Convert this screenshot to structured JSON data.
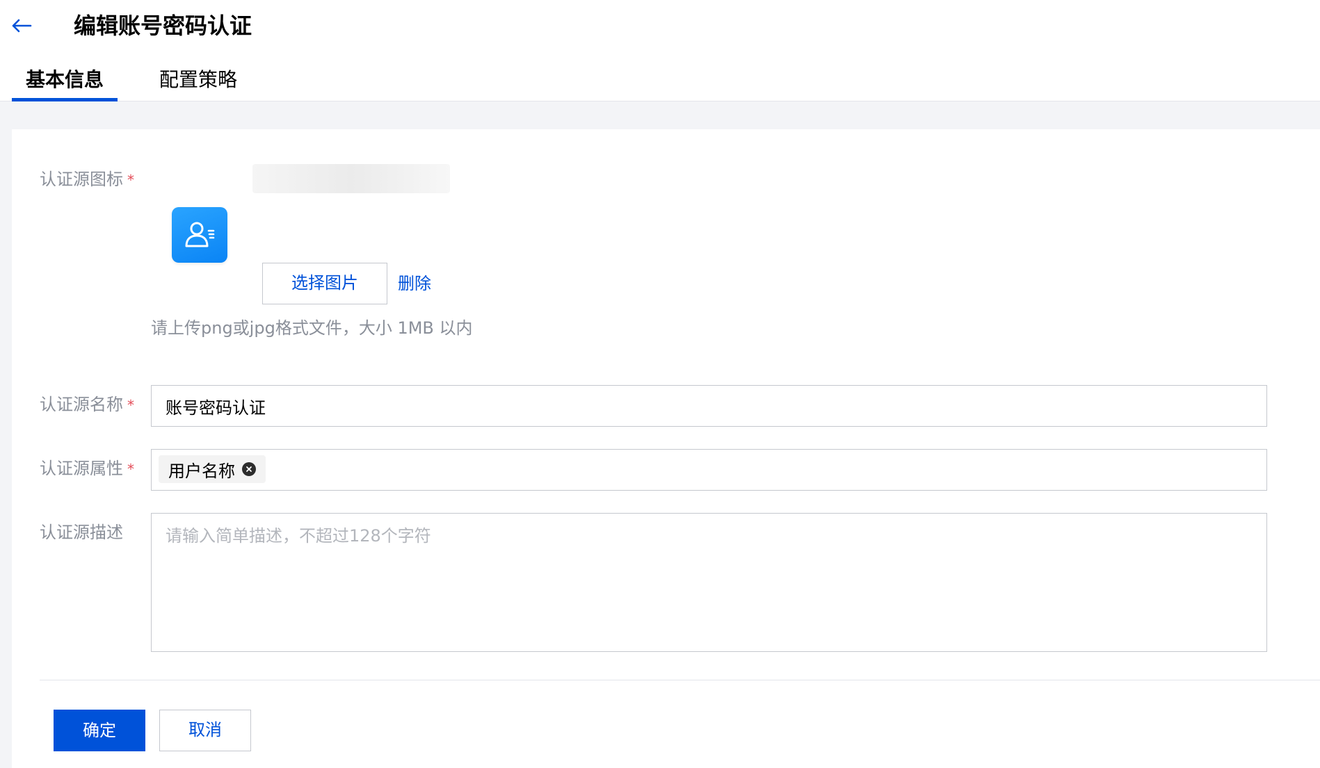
{
  "header": {
    "title": "编辑账号密码认证",
    "back_icon": "arrow-left-icon"
  },
  "tabs": [
    {
      "label": "基本信息",
      "active": true
    },
    {
      "label": "配置策略",
      "active": false
    }
  ],
  "form": {
    "icon_field": {
      "label": "认证源图标",
      "required_mark": "*",
      "select_button": "选择图片",
      "delete_link": "删除",
      "hint": "请上传png或jpg格式文件，大小 1MB 以内",
      "preview_icon": "user-account-icon"
    },
    "name_field": {
      "label": "认证源名称",
      "required_mark": "*",
      "value": "账号密码认证"
    },
    "attr_field": {
      "label": "认证源属性",
      "required_mark": "*",
      "tags": [
        {
          "label": "用户名称"
        }
      ]
    },
    "desc_field": {
      "label": "认证源描述",
      "placeholder": "请输入简单描述，不超过128个字符",
      "value": ""
    }
  },
  "actions": {
    "confirm": "确定",
    "cancel": "取消"
  },
  "colors": {
    "primary": "#0052d9",
    "required": "#e34d59",
    "label": "#8a8f99",
    "icon_bg": "#1a94fb"
  }
}
